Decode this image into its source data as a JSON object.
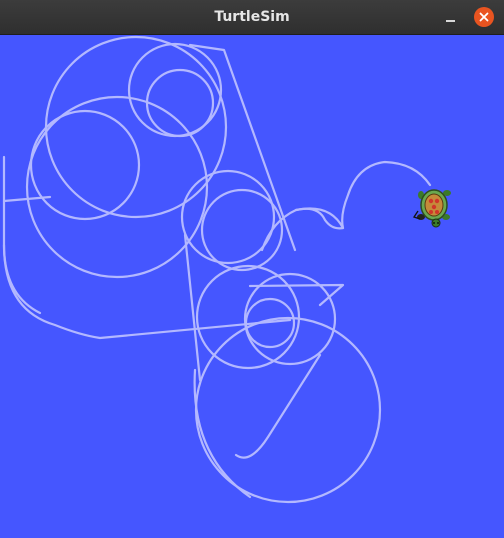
{
  "window": {
    "title": "TurtleSim"
  },
  "controls": {
    "minimize_icon": "minimize-icon",
    "close_icon": "close-icon"
  },
  "colors": {
    "background": "#4556ff",
    "pen": "#b3b8ff",
    "close": "#e95420"
  }
}
